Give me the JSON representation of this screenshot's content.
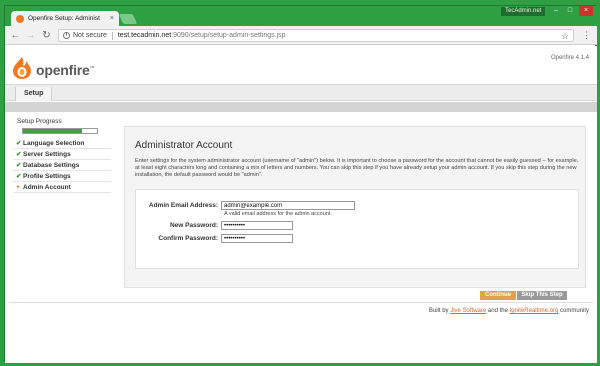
{
  "browser": {
    "tab_title": "Openfire Setup: Administ",
    "window_label": "TecAdmin.net",
    "window_controls": [
      "–",
      "□",
      "×"
    ],
    "security_label": "Not secure",
    "url_host": "test.tecadmin.net",
    "url_path": ":9090/setup/setup-admin-settings.jsp"
  },
  "header": {
    "logo_text": "openfire",
    "trademark": "™",
    "version": "Openfire 4.1.4"
  },
  "nav": {
    "tab_label": "Setup"
  },
  "sidebar": {
    "progress_label": "Setup Progress",
    "progress_fraction": 0.8,
    "steps": [
      {
        "label": "Language Selection",
        "state": "done"
      },
      {
        "label": "Server Settings",
        "state": "done"
      },
      {
        "label": "Database Settings",
        "state": "done"
      },
      {
        "label": "Profile Settings",
        "state": "done"
      },
      {
        "label": "Admin Account",
        "state": "current"
      }
    ]
  },
  "main": {
    "title": "Administrator Account",
    "description": "Enter settings for the system administrator account (username of \"admin\") below. It is important to choose a password for the account that cannot be easily guessed -- for example, at least eight characters long and containing a mix of letters and numbers. You can skip this step if you have already setup your admin account. If you skip this step during the new installation, the default password would be \"admin\".",
    "form": {
      "email_label": "Admin Email Address:",
      "email_value": "admin@example.com",
      "email_help": "A valid email address for the admin account.",
      "new_password_label": "New Password:",
      "new_password_value": "••••••••••",
      "confirm_password_label": "Confirm Password:",
      "confirm_password_value": "••••••••••"
    },
    "continue_label": "Continue",
    "skip_label": "Skip This Step"
  },
  "footer": {
    "prefix": "Built by",
    "link1": "Jive Software",
    "middle": "and the",
    "link2": "IgniteRealtime.org",
    "suffix": "community"
  },
  "colors": {
    "window_green": "#2ea043",
    "accent_orange": "#e0a150",
    "progress_green": "#3fa23f",
    "link_orange": "#d9682a"
  }
}
